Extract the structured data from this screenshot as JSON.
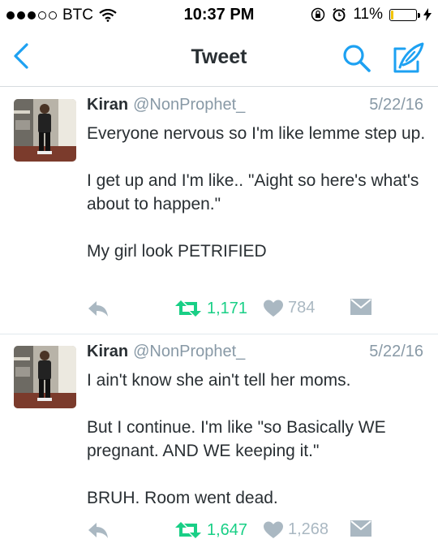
{
  "status_bar": {
    "carrier": "BTC",
    "time": "10:37 PM",
    "battery": "11%",
    "battery_level": 0.11,
    "signal_bars_filled": 3,
    "signal_bars_total": 5
  },
  "nav": {
    "title": "Tweet",
    "back_icon": "chevron-left-icon",
    "search_icon": "search-icon",
    "compose_icon": "compose-feather-icon",
    "accent_color": "#1da1f2"
  },
  "tweets": [
    {
      "name": "Kiran",
      "handle": "@NonProphet_",
      "date": "5/22/16",
      "text": "Everyone nervous so I'm like lemme step up.\n\nI get up and I'm like.. \"Aight so here's what's about to happen.\"\n\nMy girl look PETRIFIED",
      "retweets": "1,171",
      "likes": "784"
    },
    {
      "name": "Kiran",
      "handle": "@NonProphet_",
      "date": "5/22/16",
      "text": "I ain't know she ain't tell her moms.\n\nBut I continue. I'm like \"so Basically WE pregnant. AND WE keeping it.\"\n\nBRUH. Room went dead.",
      "retweets": "1,647",
      "likes": "1,268"
    }
  ],
  "colors": {
    "retweet_active": "#19cf86",
    "muted": "#8899a6"
  }
}
